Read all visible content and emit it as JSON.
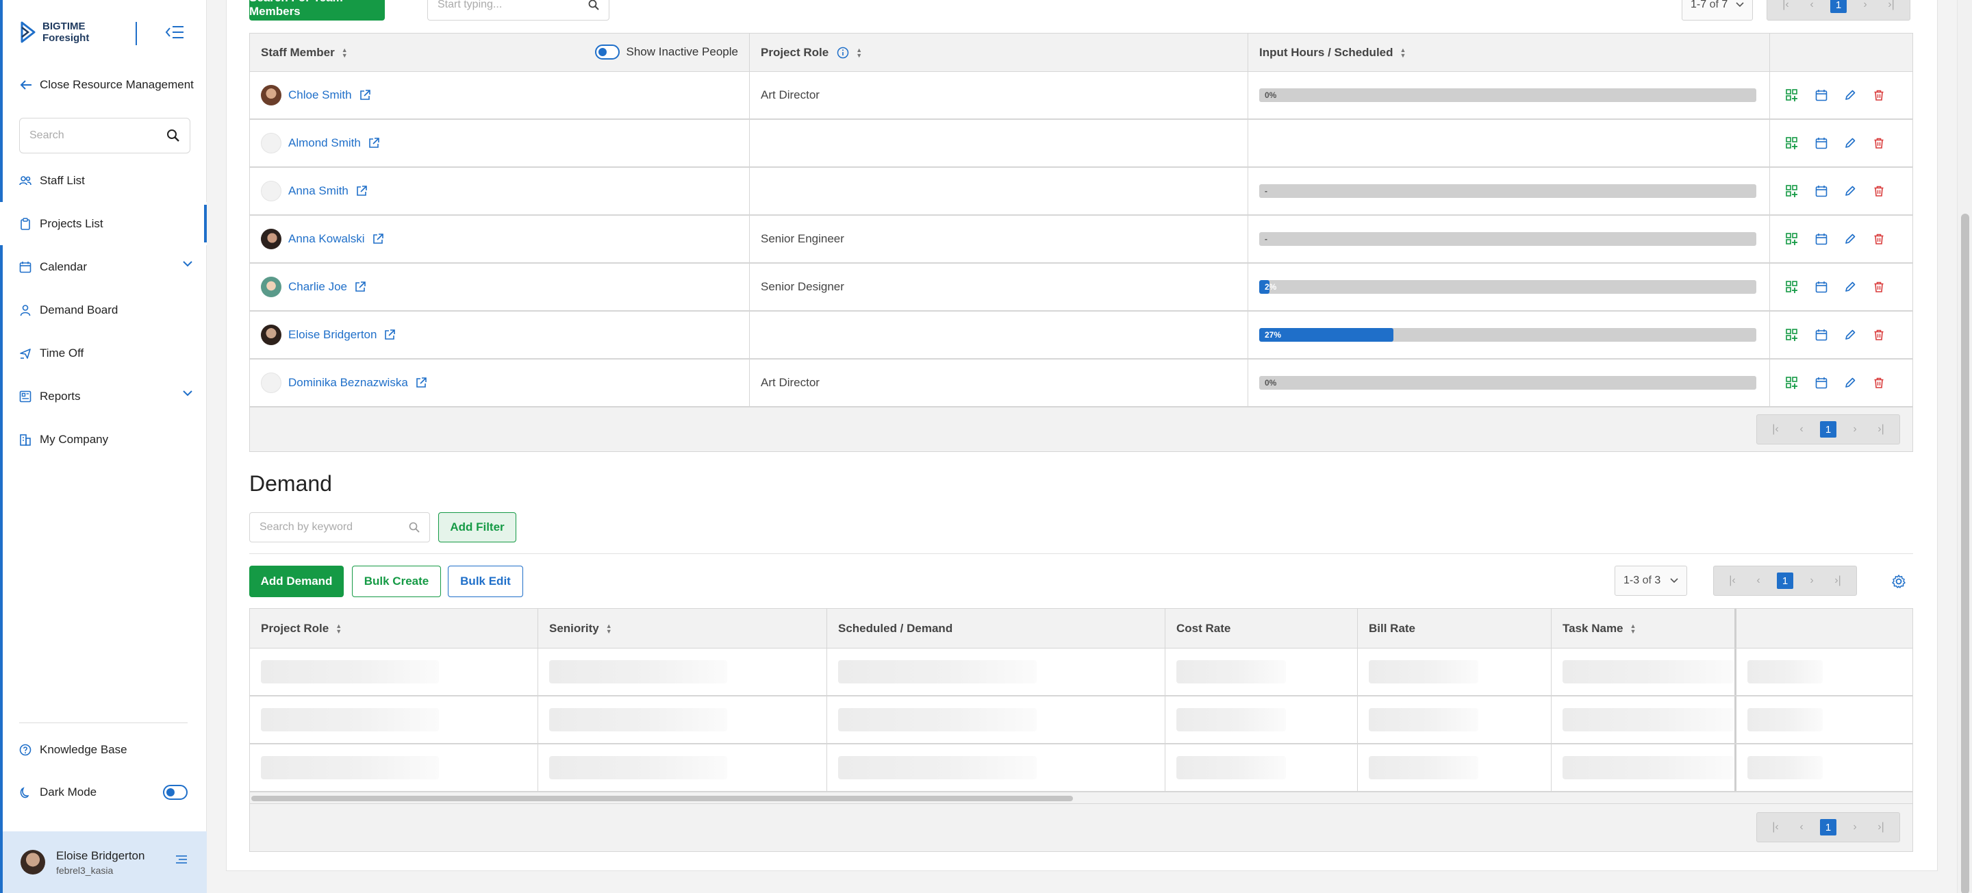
{
  "brand": {
    "line1": "BIGTIME",
    "line2": "Foresight"
  },
  "sidebar": {
    "close_label": "Close Resource Management",
    "search_placeholder": "Search",
    "items": [
      {
        "label": "Staff List",
        "icon": "people-icon"
      },
      {
        "label": "Projects List",
        "icon": "clipboard-icon",
        "active": true
      },
      {
        "label": "Calendar",
        "icon": "calendar-icon",
        "expandable": true
      },
      {
        "label": "Demand Board",
        "icon": "person-icon"
      },
      {
        "label": "Time Off",
        "icon": "plane-icon"
      },
      {
        "label": "Reports",
        "icon": "report-icon",
        "expandable": true
      },
      {
        "label": "My Company",
        "icon": "building-icon"
      }
    ],
    "knowledge_base": "Knowledge Base",
    "dark_mode": "Dark Mode",
    "user": {
      "name": "Eloise Bridgerton",
      "handle": "febrel3_kasia"
    }
  },
  "team": {
    "search_button": "Search For Team Members",
    "search_placeholder": "Start typing...",
    "count": {
      "range": "1-7",
      "of": "of",
      "total": "7"
    },
    "page": "1",
    "show_inactive": "Show Inactive People",
    "columns": {
      "staff": "Staff Member",
      "role": "Project Role",
      "hours": "Input Hours / Scheduled"
    },
    "rows": [
      {
        "name": "Chloe Smith",
        "role": "Art Director",
        "bar_label": "0%",
        "fill": 0,
        "has_bar": true,
        "avatar": "photo-a"
      },
      {
        "name": "Almond Smith",
        "role": "",
        "bar_label": "",
        "fill": 0,
        "has_bar": false,
        "avatar": "empty"
      },
      {
        "name": "Anna Smith",
        "role": "",
        "bar_label": "-",
        "fill": 0,
        "has_bar": true,
        "avatar": "empty"
      },
      {
        "name": "Anna Kowalski",
        "role": "Senior Engineer",
        "bar_label": "-",
        "fill": 0,
        "has_bar": true,
        "avatar": "photo-b"
      },
      {
        "name": "Charlie Joe",
        "role": "Senior Designer",
        "bar_label": "2%",
        "fill": 0.02,
        "has_bar": true,
        "avatar": "photo-c"
      },
      {
        "name": "Eloise Bridgerton",
        "role": "",
        "bar_label": "27%",
        "fill": 0.27,
        "has_bar": true,
        "avatar": "photo-d"
      },
      {
        "name": "Dominika Beznazwiska",
        "role": "Art Director",
        "bar_label": "0%",
        "fill": 0,
        "has_bar": true,
        "avatar": "empty"
      }
    ]
  },
  "demand": {
    "title": "Demand",
    "search_placeholder": "Search by keyword",
    "add_filter": "Add Filter",
    "add_demand": "Add Demand",
    "bulk_create": "Bulk Create",
    "bulk_edit": "Bulk Edit",
    "count": {
      "range": "1-3",
      "of": "of",
      "total": "3"
    },
    "page": "1",
    "columns": [
      "Project Role",
      "Seniority",
      "Scheduled / Demand",
      "Cost Rate",
      "Bill Rate",
      "Task Name",
      ""
    ]
  },
  "colors": {
    "accent": "#1f6fc9",
    "green": "#159a45",
    "delete": "#d93b3b"
  }
}
